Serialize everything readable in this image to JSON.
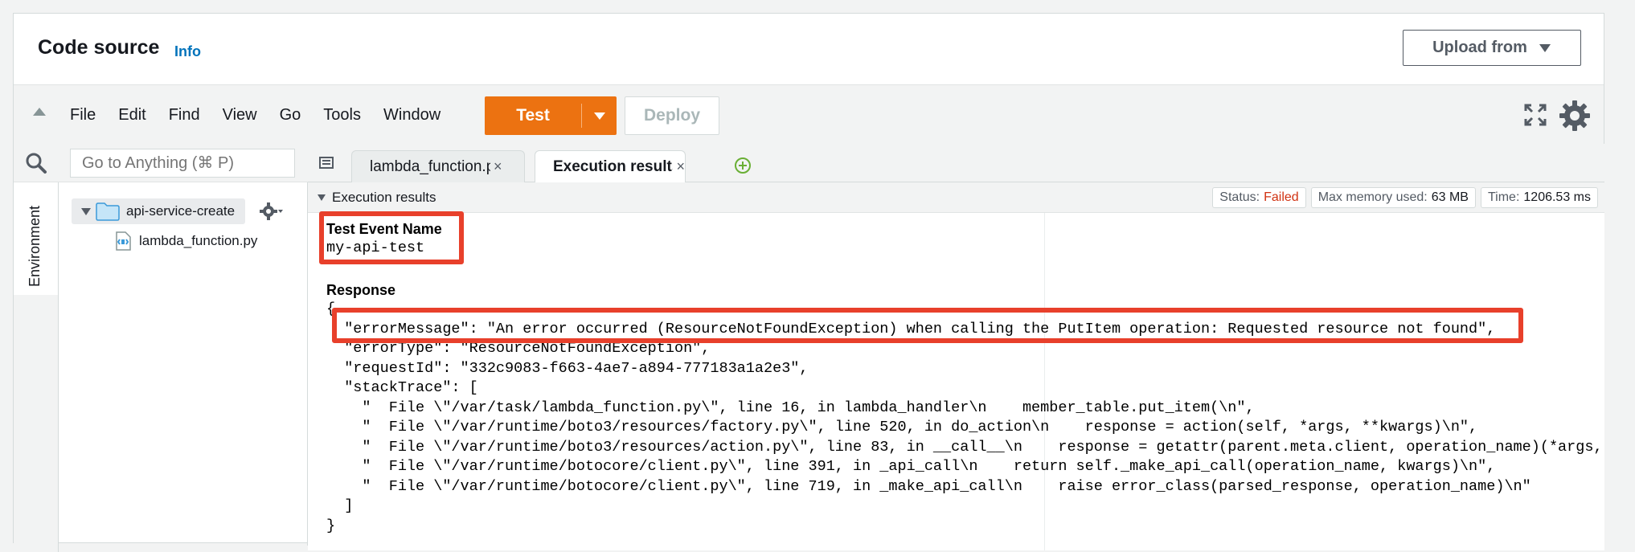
{
  "header": {
    "title": "Code source",
    "info_link": "Info",
    "upload_button": "Upload from"
  },
  "menu": {
    "items": [
      "File",
      "Edit",
      "Find",
      "View",
      "Go",
      "Tools",
      "Window"
    ],
    "test_button": "Test",
    "deploy_button": "Deploy"
  },
  "sidebar": {
    "search_placeholder": "Go to Anything (⌘ P)",
    "env_tab_label": "Environment",
    "folder_name": "api-service-create",
    "file_name": "lambda_function.py"
  },
  "tabs": [
    {
      "label": "lambda_function.py",
      "close": "×"
    },
    {
      "label": "Execution results",
      "close": "×"
    }
  ],
  "results": {
    "section_title": "Execution results",
    "status_label": "Status:",
    "status_value": "Failed",
    "memory_label": "Max memory used:",
    "memory_value": "63 MB",
    "time_label": "Time:",
    "time_value": "1206.53 ms",
    "test_event_label": "Test Event Name",
    "test_event_value": "my-api-test",
    "response_label": "Response",
    "response_lines": [
      "{",
      "  \"errorMessage\": \"An error occurred (ResourceNotFoundException) when calling the PutItem operation: Requested resource not found\",",
      "  \"errorType\": \"ResourceNotFoundException\",",
      "  \"requestId\": \"332c9083-f663-4ae7-a894-777183a1a2e3\",",
      "  \"stackTrace\": [",
      "    \"  File \\\"/var/task/lambda_function.py\\\", line 16, in lambda_handler\\n    member_table.put_item(\\n\",",
      "    \"  File \\\"/var/runtime/boto3/resources/factory.py\\\", line 520, in do_action\\n    response = action(self, *args, **kwargs)\\n\",",
      "    \"  File \\\"/var/runtime/boto3/resources/action.py\\\", line 83, in __call__\\n    response = getattr(parent.meta.client, operation_name)(*args,",
      "    \"  File \\\"/var/runtime/botocore/client.py\\\", line 391, in _api_call\\n    return self._make_api_call(operation_name, kwargs)\\n\",",
      "    \"  File \\\"/var/runtime/botocore/client.py\\\", line 719, in _make_api_call\\n    raise error_class(parsed_response, operation_name)\\n\"",
      "  ]",
      "}"
    ]
  },
  "colors": {
    "accent_orange": "#ec7211",
    "link_blue": "#0073bb",
    "failed_red": "#d13212",
    "highlight_red": "#e8402b"
  }
}
